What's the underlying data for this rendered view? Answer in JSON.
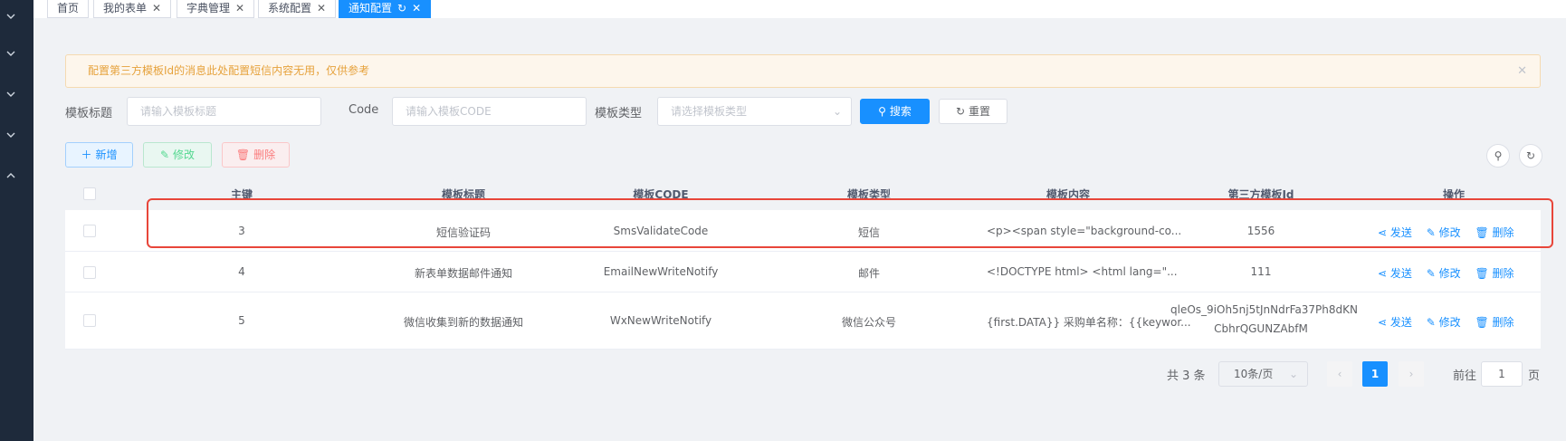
{
  "tabs": [
    {
      "label": "首页"
    },
    {
      "label": "我的表单"
    },
    {
      "label": "字典管理"
    },
    {
      "label": "系统配置"
    },
    {
      "label": "通知配置"
    }
  ],
  "alert": {
    "text": "配置第三方模板Id的消息此处配置短信内容无用，仅供参考"
  },
  "search": {
    "title_label": "模板标题",
    "title_placeholder": "请输入模板标题",
    "code_label": "Code",
    "code_placeholder": "请输入模板CODE",
    "type_label": "模板类型",
    "type_placeholder": "请选择模板类型",
    "search_btn": "搜索",
    "reset_btn": "重置"
  },
  "toolbar": {
    "add": "新增",
    "edit": "修改",
    "delete": "删除"
  },
  "table": {
    "headers": [
      "主键",
      "模板标题",
      "模板CODE",
      "模板类型",
      "模板内容",
      "第三方模板Id",
      "操作"
    ],
    "rows": [
      {
        "id": "3",
        "title": "短信验证码",
        "code": "SmsValidateCode",
        "type": "短信",
        "content": "<p><span style=\"background-co...",
        "third_id": "1556",
        "third_id2": ""
      },
      {
        "id": "4",
        "title": "新表单数据邮件通知",
        "code": "EmailNewWriteNotify",
        "type": "邮件",
        "content": "<!DOCTYPE html> <html lang=\"...",
        "third_id": "111",
        "third_id2": ""
      },
      {
        "id": "5",
        "title": "微信收集到新的数据通知",
        "code": "WxNewWriteNotify",
        "type": "微信公众号",
        "content": "{first.DATA}} 采购单名称：{{keywor...",
        "third_id": "qleOs_9iOh5nj5tJnNdrFa37Ph8dKN",
        "third_id2": "CbhrQGUNZAbfM"
      }
    ],
    "ops": {
      "send": "发送",
      "edit": "修改",
      "delete": "删除"
    }
  },
  "pagination": {
    "total": "共 3 条",
    "page_size": "10条/页",
    "current": "1",
    "goto_label": "前往",
    "goto_value": "1",
    "page_suffix": "页"
  },
  "colors": {
    "primary": "#1890ff",
    "highlight": "#e8463a",
    "warning": "#e6a23c"
  }
}
